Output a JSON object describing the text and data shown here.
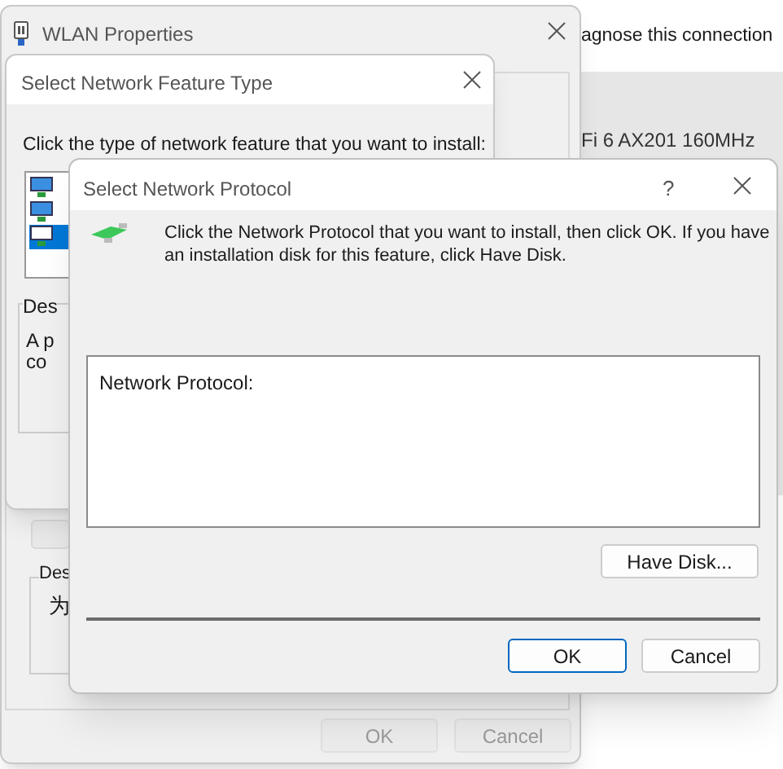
{
  "background": {
    "link": "agnose this connection",
    "adapter": "Fi 6 AX201 160MHz"
  },
  "wlan_properties": {
    "title": "WLAN Properties",
    "description_label": "Des",
    "description_text": "为",
    "buttons": [
      {
        "label": "OK",
        "disabled": true
      },
      {
        "label": "Cancel",
        "disabled": true
      }
    ]
  },
  "feature_type": {
    "title": "Select Network Feature Type",
    "instruction": "Click the type of network feature that you want to install:",
    "items": [
      {
        "selected": false
      },
      {
        "selected": false
      },
      {
        "selected": true
      }
    ],
    "description_label": "Des",
    "description_lines": [
      "A p",
      "co"
    ]
  },
  "protocol": {
    "title": "Select Network Protocol",
    "help": "?",
    "instruction": "Click the Network Protocol that you want to install, then click OK. If you have an installation disk for this feature, click Have Disk.",
    "list_heading": "Network Protocol:",
    "have_disk": "Have Disk...",
    "buttons": [
      {
        "label": "OK",
        "default": true
      },
      {
        "label": "Cancel",
        "default": false
      }
    ]
  }
}
